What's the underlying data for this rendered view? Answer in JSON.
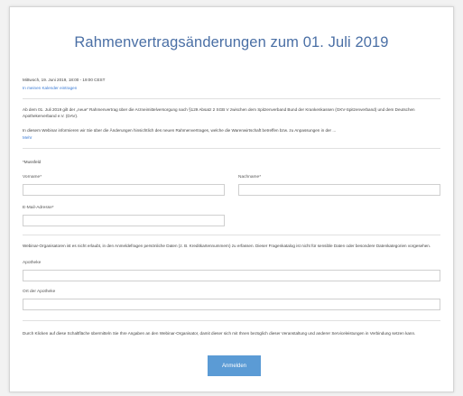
{
  "page_title": "Rahmenvertragsänderungen zum 01. Juli 2019",
  "datetime": "Mittwoch, 19. Juni 2019, 18:00 - 19:00 CEST",
  "calendar_link": "In meinen Kalender eintragen",
  "intro_1": "Ab dem 01. Juli 2019 gilt der „neue“ Rahmenvertrag über die Arzneimittelversorgung nach §129 Absatz 2 SGB V zwischen dem Spitzenverband Bund der Krankenkassen (GKV-Spitzenverband) und dem Deutschen Apothekerverband e.V. (DAV).",
  "intro_2": "In diesem Webinar informieren wir Sie über die Änderungen hinsichtlich des neuen Rahmenvertrages, welche die Warenwirtschaft betreffen bzw. zu Anpassungen in der ...",
  "more_link": "Mehr",
  "required_note": "*Muss­feld",
  "form": {
    "first_name_label": "Vorname*",
    "last_name_label": "Nachname*",
    "email_label": "E-Mail-Adresse*",
    "first_name_value": "",
    "last_name_value": "",
    "email_value": "",
    "pharmacy_label": "Apotheke",
    "pharmacy_value": "",
    "city_label": "Ort der Apotheke",
    "city_value": ""
  },
  "organizer_note": "Webinar-Organisatoren ist es nicht erlaubt, in den Anmeldefragen persönliche Daten (z. B. Kreditkartennummern) zu erfassen. Dieser Fragenkatalog ist nicht für sensible Daten oder besondere Datenkategorien vorgesehen.",
  "consent_note": "Durch Klicken auf diese Schaltfläche übermitteln Sie Ihre Angaben an den Webinar-Organisator, damit dieser sich mit Ihnen bezüglich dieser Veranstaltung und anderer Serviceleistungen in Verbindung setzen kann.",
  "submit_label": "Anmelden",
  "colors": {
    "accent": "#5b9bd5",
    "title": "#4a6fa5",
    "link": "#3a7bd5"
  }
}
